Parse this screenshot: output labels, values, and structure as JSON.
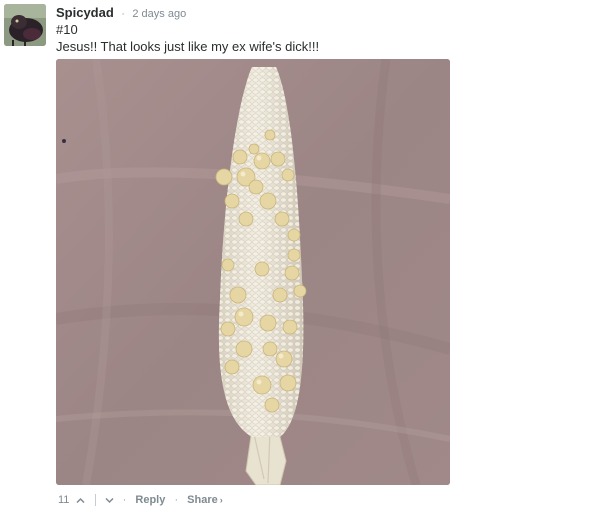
{
  "comment": {
    "author": "Spicydad",
    "separator": "·",
    "timestamp": "2 days ago",
    "lines": [
      "#10",
      "Jesus!! That looks just like my ex wife's dick!!!"
    ],
    "image_subject": "corn cob on cloth",
    "avatar_subject": "dark bird"
  },
  "footer": {
    "upvotes": "11",
    "upvote_icon": "chevron-up-icon",
    "downvote_icon": "chevron-down-icon",
    "reply_label": "Reply",
    "dot": "·",
    "share_label": "Share",
    "share_chevron": "›"
  },
  "colors": {
    "text": "#2a2e2e",
    "meta": "#7f8b91",
    "cloth": "#9f8a8a",
    "kernel_white": "#e9e3d3",
    "kernel_yellow": "#e2cf93"
  }
}
